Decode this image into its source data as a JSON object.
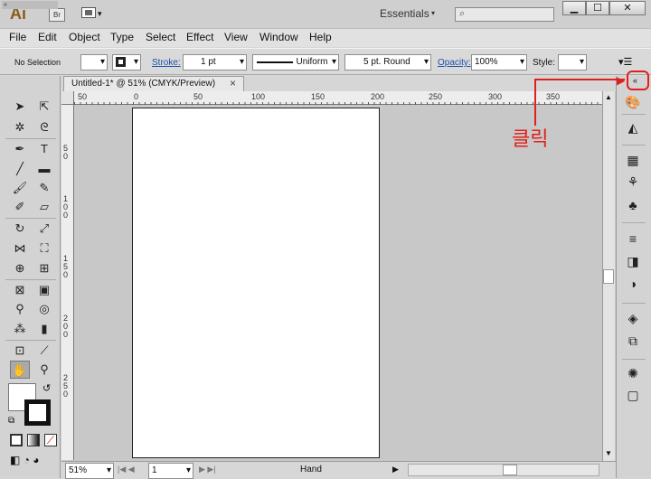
{
  "app": {
    "logo": "Ai",
    "bridge": "Br",
    "workspace": "Essentials",
    "window_buttons": [
      "▁",
      "☐",
      "✕"
    ]
  },
  "menu": [
    "File",
    "Edit",
    "Object",
    "Type",
    "Select",
    "Effect",
    "View",
    "Window",
    "Help"
  ],
  "control_bar": {
    "selection": "No Selection",
    "stroke_label": "Stroke:",
    "stroke_value": "1 pt",
    "profile": "Uniform",
    "brush": "5 pt. Round",
    "opacity_label": "Opacity:",
    "opacity_value": "100%",
    "style_label": "Style:"
  },
  "document": {
    "tab_title": "Untitled-1* @ 51% (CMYK/Preview)",
    "ruler_h": [
      "50",
      "0",
      "50",
      "100",
      "150",
      "200",
      "250",
      "300",
      "350"
    ],
    "ruler_v": [
      "5\n0",
      "1\n0\n0",
      "1\n5\n0",
      "2\n0\n0",
      "2\n5\n0"
    ]
  },
  "status": {
    "zoom": "51%",
    "page": "1",
    "tool": "Hand"
  },
  "annotation": {
    "label": "클릭"
  },
  "colors": {
    "annotation": "#e0201c",
    "link": "#1d50a8"
  }
}
